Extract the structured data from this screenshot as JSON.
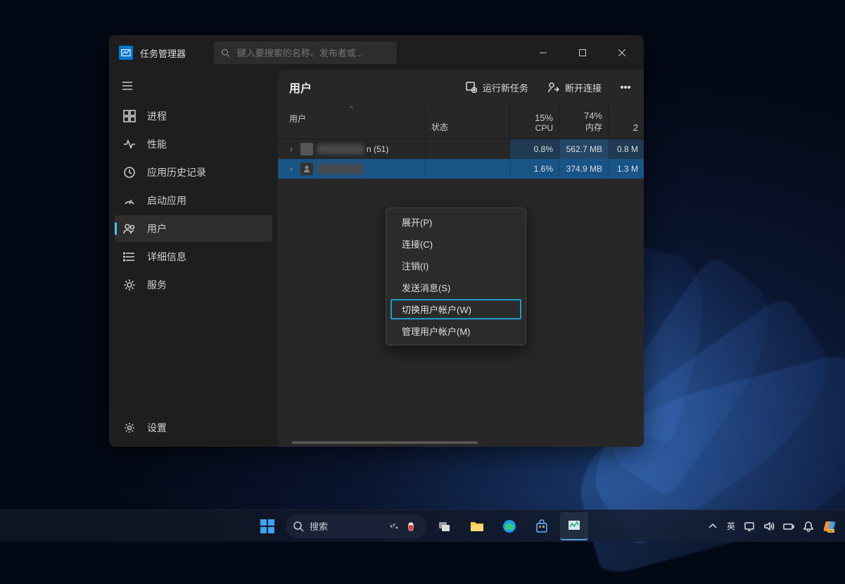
{
  "app": {
    "title": "任务管理器"
  },
  "search": {
    "placeholder": "键入要搜索的名称、发布者或..."
  },
  "sidebar": {
    "items": [
      {
        "label": "进程"
      },
      {
        "label": "性能"
      },
      {
        "label": "应用历史记录"
      },
      {
        "label": "启动应用"
      },
      {
        "label": "用户"
      },
      {
        "label": "详细信息"
      },
      {
        "label": "服务"
      }
    ],
    "settings_label": "设置"
  },
  "content": {
    "title": "用户",
    "toolbar": {
      "run_new_task": "运行新任务",
      "disconnect": "断开连接"
    },
    "columns": {
      "user": "用户",
      "status": "状态",
      "cpu_pct": "15%",
      "cpu_label": "CPU",
      "mem_pct": "74%",
      "mem_label": "内存",
      "extra": "2"
    },
    "rows": [
      {
        "suffix": "n (51)",
        "cpu": "0.8%",
        "mem": "562.7 MB",
        "extra": "0.8 M"
      },
      {
        "suffix": "",
        "cpu": "1.6%",
        "mem": "374.9 MB",
        "extra": "1.3 M"
      }
    ]
  },
  "context_menu": {
    "items": [
      {
        "label": "展开(P)"
      },
      {
        "label": "连接(C)"
      },
      {
        "label": "注销(I)"
      },
      {
        "label": "发送消息(S)"
      },
      {
        "label": "切换用户帐户(W)"
      },
      {
        "label": "管理用户帐户(M)"
      }
    ]
  },
  "taskbar": {
    "search_label": "搜索",
    "ime": "英"
  }
}
